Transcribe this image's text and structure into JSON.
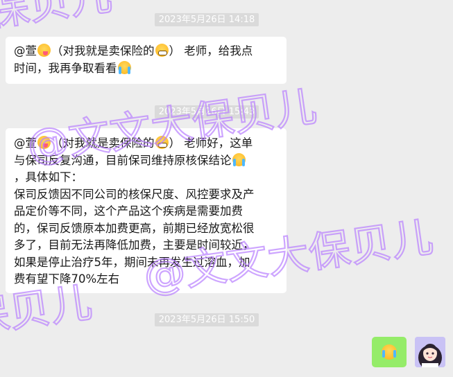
{
  "chat": {
    "timestamps": [
      "2023年5月26日 14:18",
      "2023年5月26日 15:43",
      "2023年5月26日 15:50"
    ],
    "messages": [
      {
        "sender": "incoming",
        "lines": [
          [
            "@萱",
            "（对我就是卖保险的",
            "） 老师，给我点"
          ],
          [
            "时间，我再争取看看"
          ]
        ]
      },
      {
        "sender": "incoming",
        "lines": [
          [
            "@萱",
            "（对我就是卖保险的",
            "） 老师好，这单"
          ],
          [
            "与保司反复沟通，目前保司维持原核保结论"
          ],
          [
            "，具体如下："
          ],
          [
            "保司反馈因不同公司的核保尺度、风控要求及产"
          ],
          [
            "品定价等不同，这个产品这个疾病是需要加费"
          ],
          [
            "的，保司反馈原本加费更高，前期已经放宽松很"
          ],
          [
            "多了，目前无法再降低加费，主要是时间较近，"
          ],
          [
            "如果是停止治疗5年，期间未再发生过溶血，加"
          ],
          [
            "费有望下降70%左右"
          ]
        ]
      },
      {
        "sender": "outgoing",
        "content": "crying-face-sticker"
      }
    ]
  },
  "watermark": {
    "text": "@文文大保贝儿",
    "color": "#b980ff"
  },
  "colors": {
    "background": "#ededed",
    "incoming_bubble": "#ffffff",
    "outgoing_bubble": "#95ec69",
    "timestamp_bg": "#dadada",
    "timestamp_text": "#ffffff"
  },
  "icons": [
    "yum-face-icon",
    "grimace-face-icon",
    "loudly-crying-face-icon",
    "user-avatar"
  ]
}
